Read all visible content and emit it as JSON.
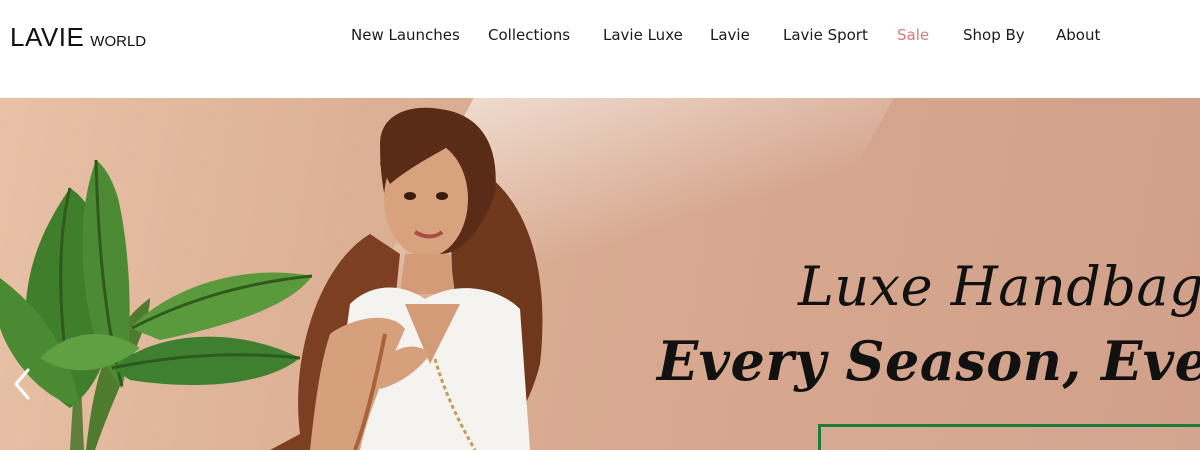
{
  "brand": {
    "name": "LAVIE",
    "suffix": "WORLD"
  },
  "nav": [
    {
      "label": "New Launches"
    },
    {
      "label": "Collections"
    },
    {
      "label": "Lavie Luxe"
    },
    {
      "label": "Lavie"
    },
    {
      "label": "Lavie Sport"
    },
    {
      "label": "Sale"
    },
    {
      "label": "Shop By"
    },
    {
      "label": "About"
    }
  ],
  "hero": {
    "line1": "Luxe Handbags",
    "line2": "Every Season, Every O"
  },
  "colors": {
    "sale": "#d77a7a",
    "cta_border": "#1f7a3d",
    "background": "#d7a78f"
  },
  "icons": {
    "carousel_prev": "chevron-left-icon"
  }
}
